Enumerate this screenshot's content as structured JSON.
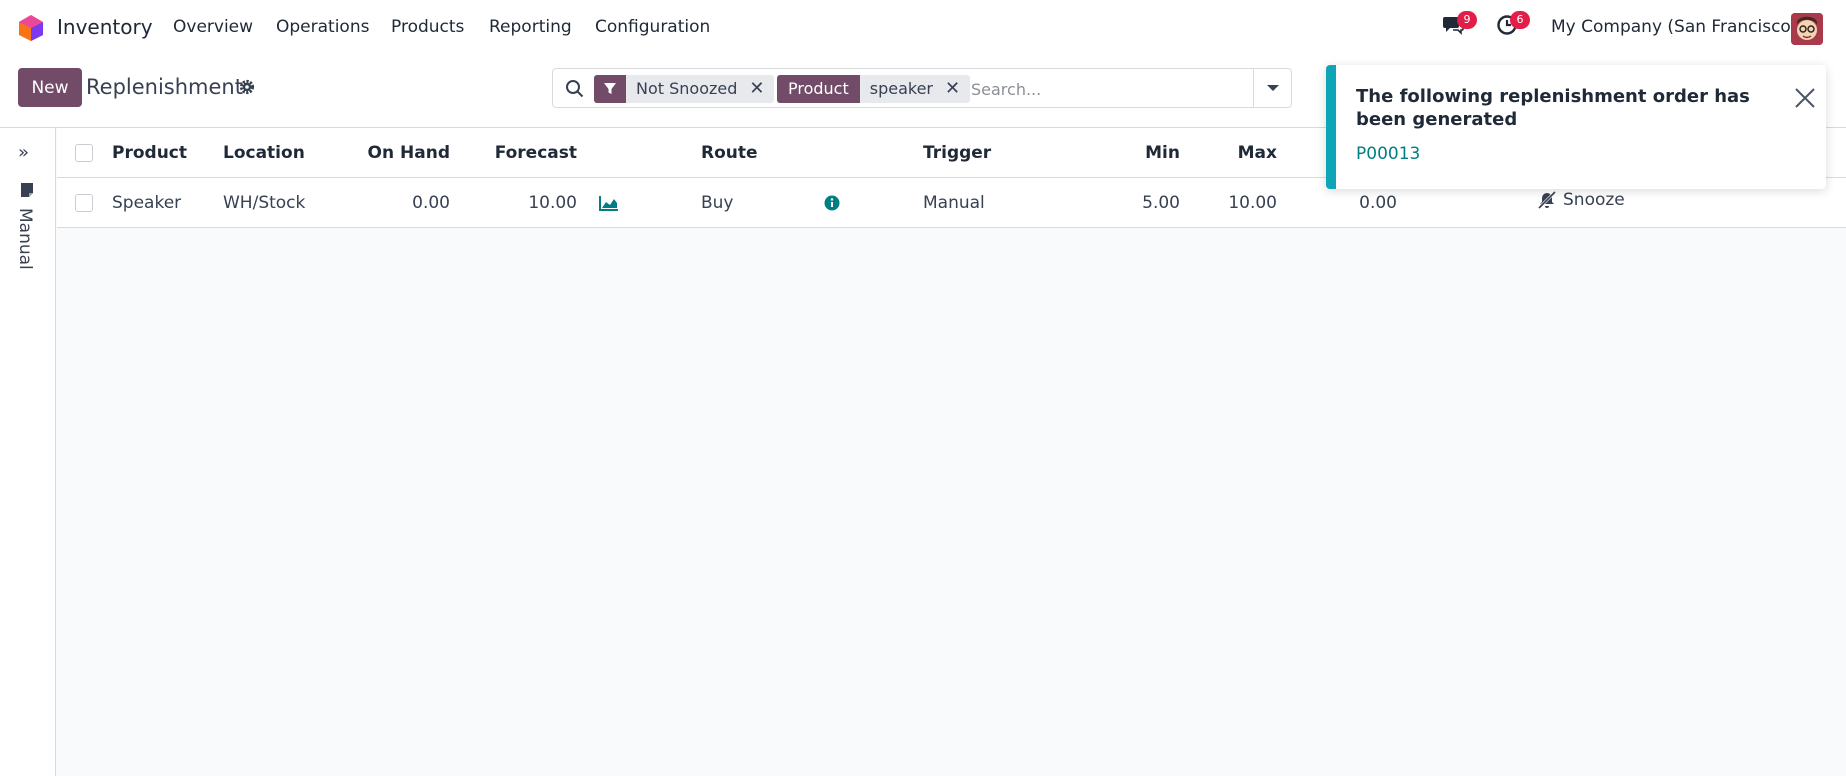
{
  "app": {
    "name": "Inventory",
    "menu": [
      "Overview",
      "Operations",
      "Products",
      "Reporting",
      "Configuration"
    ],
    "messages_count": "9",
    "activities_count": "6",
    "company": "My Company (San Francisco)"
  },
  "control": {
    "new_label": "New",
    "title": "Replenishment"
  },
  "search": {
    "facets": [
      {
        "label": "",
        "value": "Not Snoozed"
      },
      {
        "label": "Product",
        "value": "speaker"
      }
    ],
    "placeholder": "Search..."
  },
  "side": {
    "label": "Manual"
  },
  "table": {
    "columns": [
      "Product",
      "Location",
      "On Hand",
      "Forecast",
      "Route",
      "Trigger",
      "Min",
      "Max"
    ],
    "rows": [
      {
        "product": "Speaker",
        "location": "WH/Stock",
        "on_hand": "0.00",
        "forecast": "10.00",
        "route": "Buy",
        "trigger": "Manual",
        "min": "5.00",
        "max": "10.00",
        "to_order": "0.00",
        "action": "Snooze"
      }
    ]
  },
  "toast": {
    "message": "The following replenishment order has been generated",
    "link": "P00013"
  },
  "colors": {
    "brand": "#714b67",
    "accent": "#017e84",
    "toast_bar": "#0ea5b7",
    "badge": "#e11d48"
  }
}
